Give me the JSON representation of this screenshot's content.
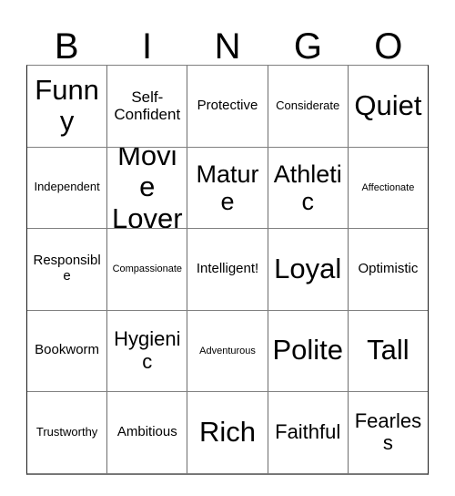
{
  "card": {
    "header_letters": [
      "B",
      "I",
      "N",
      "G",
      "O"
    ],
    "columns": 5,
    "rows": 5,
    "grid": [
      [
        {
          "label": "Funny",
          "size": "xxl"
        },
        {
          "label": "Self-Confident",
          "size": "m"
        },
        {
          "label": "Protective",
          "size": "s"
        },
        {
          "label": "Considerate",
          "size": "xs"
        },
        {
          "label": "Quiet",
          "size": "xxl"
        }
      ],
      [
        {
          "label": "Independent",
          "size": "xs"
        },
        {
          "label": "Movie Lover",
          "size": "xxl"
        },
        {
          "label": "Mature",
          "size": "xl"
        },
        {
          "label": "Athletic",
          "size": "xl"
        },
        {
          "label": "Affectionate",
          "size": "xxs"
        }
      ],
      [
        {
          "label": "Responsible",
          "size": "s"
        },
        {
          "label": "Compassionate",
          "size": "xxs"
        },
        {
          "label": "Intelligent!",
          "size": "s"
        },
        {
          "label": "Loyal",
          "size": "xxl"
        },
        {
          "label": "Optimistic",
          "size": "s"
        }
      ],
      [
        {
          "label": "Bookworm",
          "size": "s"
        },
        {
          "label": "Hygienic",
          "size": "l"
        },
        {
          "label": "Adventurous",
          "size": "xxs"
        },
        {
          "label": "Polite",
          "size": "xxl"
        },
        {
          "label": "Tall",
          "size": "xxl"
        }
      ],
      [
        {
          "label": "Trustworthy",
          "size": "xs"
        },
        {
          "label": "Ambitious",
          "size": "s"
        },
        {
          "label": "Rich",
          "size": "xxl"
        },
        {
          "label": "Faithful",
          "size": "l"
        },
        {
          "label": "Fearless",
          "size": "l"
        }
      ]
    ]
  },
  "colors": {
    "background": "#ffffff",
    "text": "#000000",
    "grid_line": "#808080",
    "border": "#1a1a1a"
  }
}
